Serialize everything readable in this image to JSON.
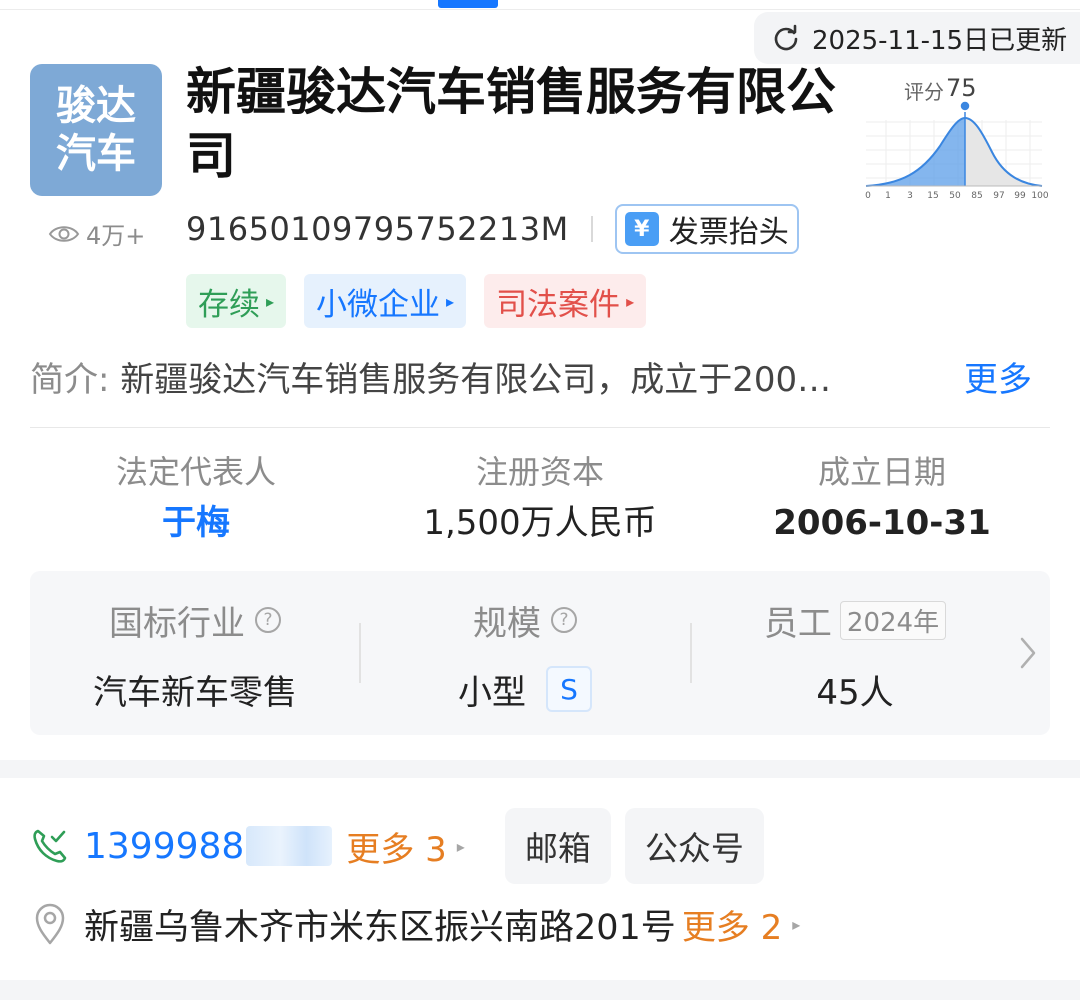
{
  "update": {
    "text": "2025-11-15日已更新",
    "icon": "refresh-icon"
  },
  "company": {
    "logo_line1": "骏达",
    "logo_line2": "汽车",
    "logo_color": "#7ea9d6",
    "views": "4万+",
    "name": "新疆骏达汽车销售服务有限公司",
    "credit_code": "91650109795752213M",
    "invoice_label": "发票抬头",
    "invoice_icon_glyph": "¥"
  },
  "tags": [
    {
      "label": "存续",
      "color": "green"
    },
    {
      "label": "小微企业",
      "color": "blue"
    },
    {
      "label": "司法案件",
      "color": "red"
    }
  ],
  "score": {
    "label": "评分",
    "value": "75",
    "ticks": [
      "0",
      "1",
      "3",
      "15",
      "50",
      "85",
      "97",
      "99",
      "100"
    ]
  },
  "intro": {
    "label": "简介:",
    "text": "新疆骏达汽车销售服务有限公司，成立于200…",
    "more": "更多"
  },
  "keyinfo": {
    "legal_rep_label": "法定代表人",
    "legal_rep_value": "于梅",
    "capital_label": "注册资本",
    "capital_value": "1,500万人民币",
    "founded_label": "成立日期",
    "founded_value": "2006-10-31"
  },
  "panel": {
    "industry_label": "国标行业",
    "industry_value": "汽车新车零售",
    "scale_label": "规模",
    "scale_value": "小型",
    "scale_badge": "S",
    "staff_label": "员工",
    "staff_year": "2024年",
    "staff_value": "45人",
    "help_glyph": "?"
  },
  "contact": {
    "phone": "1399988",
    "phone_more": "更多 3",
    "email_label": "邮箱",
    "wechat_label": "公众号",
    "address": "新疆乌鲁木齐市米东区振兴南路201号",
    "address_more": "更多 2"
  },
  "colors": {
    "accent": "#1677ff",
    "orange": "#e67e22",
    "green_tag": "#2f9e57",
    "red_tag": "#e2504a"
  }
}
